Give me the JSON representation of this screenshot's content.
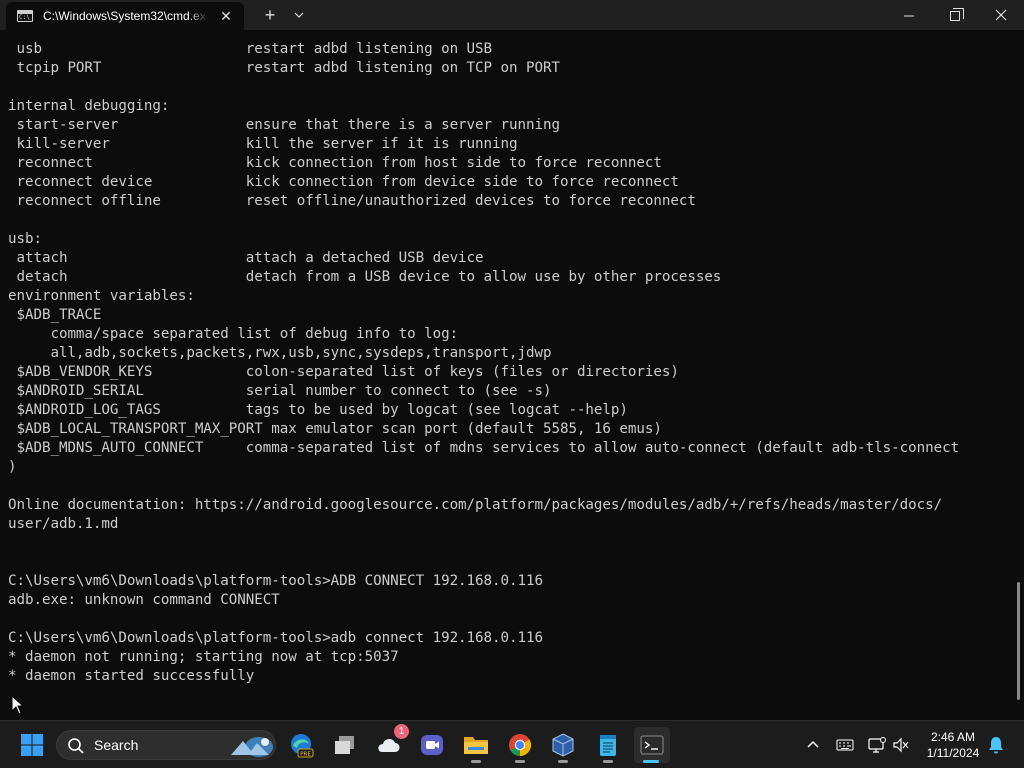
{
  "window": {
    "tab_title": "C:\\Windows\\System32\\cmd.exe",
    "tab_icon": "cmd-icon",
    "close_tab_glyph": "✕",
    "new_tab_glyph": "+",
    "dropdown_glyph": "⌵",
    "minimize_glyph": "—",
    "close_glyph": "✕"
  },
  "console": {
    "lines": [
      " usb                        restart adbd listening on USB",
      " tcpip PORT                 restart adbd listening on TCP on PORT",
      "",
      "internal debugging:",
      " start-server               ensure that there is a server running",
      " kill-server                kill the server if it is running",
      " reconnect                  kick connection from host side to force reconnect",
      " reconnect device           kick connection from device side to force reconnect",
      " reconnect offline          reset offline/unauthorized devices to force reconnect",
      "",
      "usb:",
      " attach                     attach a detached USB device",
      " detach                     detach from a USB device to allow use by other processes",
      "environment variables:",
      " $ADB_TRACE",
      "     comma/space separated list of debug info to log:",
      "     all,adb,sockets,packets,rwx,usb,sync,sysdeps,transport,jdwp",
      " $ADB_VENDOR_KEYS           colon-separated list of keys (files or directories)",
      " $ANDROID_SERIAL            serial number to connect to (see -s)",
      " $ANDROID_LOG_TAGS          tags to be used by logcat (see logcat --help)",
      " $ADB_LOCAL_TRANSPORT_MAX_PORT max emulator scan port (default 5585, 16 emus)",
      " $ADB_MDNS_AUTO_CONNECT     comma-separated list of mdns services to allow auto-connect (default adb-tls-connect",
      ")",
      "",
      "Online documentation: https://android.googlesource.com/platform/packages/modules/adb/+/refs/heads/master/docs/",
      "user/adb.1.md",
      "",
      "",
      "C:\\Users\\vm6\\Downloads\\platform-tools>ADB CONNECT 192.168.0.116",
      "adb.exe: unknown command CONNECT",
      "",
      "C:\\Users\\vm6\\Downloads\\platform-tools>adb connect 192.168.0.116",
      "* daemon not running; starting now at tcp:5037",
      "* daemon started successfully"
    ]
  },
  "taskbar": {
    "search_label": "Search",
    "weather_badge": "1",
    "apps": [
      {
        "name": "edge-beta-icon"
      },
      {
        "name": "task-view-icon"
      },
      {
        "name": "weather-widget-icon"
      },
      {
        "name": "meet-icon"
      },
      {
        "name": "file-explorer-icon"
      },
      {
        "name": "chrome-icon"
      },
      {
        "name": "virtualbox-icon"
      },
      {
        "name": "notepad-icon"
      },
      {
        "name": "terminal-icon"
      }
    ],
    "time": "2:46 AM",
    "date": "1/11/2024"
  },
  "colors": {
    "console_bg": "#0c0c0c",
    "console_text": "#cccccc",
    "titlebar_bg": "#202020",
    "taskbar_bg": "#1c1c1c",
    "active_indicator": "#4cc2ff"
  }
}
